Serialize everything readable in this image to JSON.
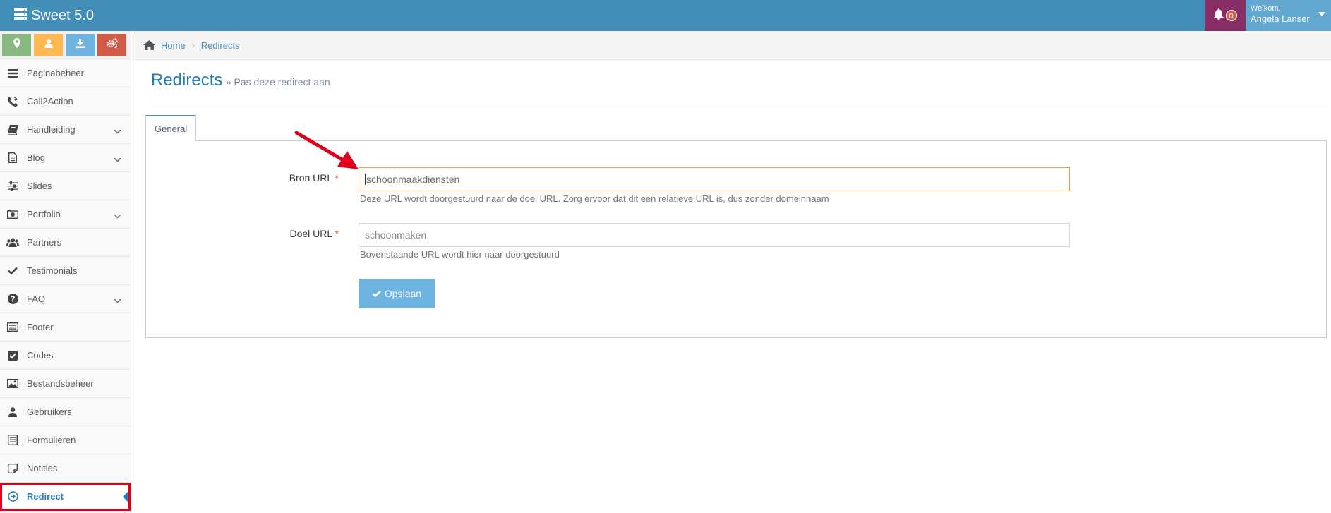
{
  "app": {
    "title": "Sweet 5.0"
  },
  "header": {
    "notifications_count": "0",
    "welcome_label": "Welkom,",
    "user_name": "Angela Lanser"
  },
  "shortcuts": [
    {
      "icon": "map-marker-icon",
      "color": "#87b87f"
    },
    {
      "icon": "user-icon",
      "color": "#ffb752"
    },
    {
      "icon": "download-icon",
      "color": "#6fb3e0"
    },
    {
      "icon": "cogs-icon",
      "color": "#d15b47"
    }
  ],
  "sidebar": {
    "items": [
      {
        "label": "Paginabeheer",
        "icon": "bars-icon"
      },
      {
        "label": "Call2Action",
        "icon": "phone-icon"
      },
      {
        "label": "Handleiding",
        "icon": "book-icon",
        "submenu": true
      },
      {
        "label": "Blog",
        "icon": "document-icon",
        "submenu": true
      },
      {
        "label": "Slides",
        "icon": "sliders-icon"
      },
      {
        "label": "Portfolio",
        "icon": "camera-icon",
        "submenu": true
      },
      {
        "label": "Partners",
        "icon": "users-icon"
      },
      {
        "label": "Testimonials",
        "icon": "check-icon"
      },
      {
        "label": "FAQ",
        "icon": "question-icon",
        "submenu": true
      },
      {
        "label": "Footer",
        "icon": "list-alt-icon"
      },
      {
        "label": "Codes",
        "icon": "check-square-icon"
      },
      {
        "label": "Bestandsbeheer",
        "icon": "image-icon"
      },
      {
        "label": "Gebruikers",
        "icon": "user-icon"
      },
      {
        "label": "Formulieren",
        "icon": "form-icon"
      },
      {
        "label": "Notities",
        "icon": "note-icon"
      },
      {
        "label": "Redirect",
        "icon": "arrow-circle-icon",
        "active": true
      }
    ]
  },
  "breadcrumb": {
    "home": "Home",
    "current": "Redirects"
  },
  "page": {
    "title": "Redirects",
    "subtitle": "» Pas deze redirect aan"
  },
  "tabs": [
    {
      "label": "General"
    }
  ],
  "form": {
    "source": {
      "label": "Bron URL",
      "required": "*",
      "value": "schoonmaakdiensten",
      "help": "Deze URL wordt doorgestuurd naar de doel URL. Zorg ervoor dat dit een relatieve URL is, dus zonder domeinnaam"
    },
    "target": {
      "label": "Doel URL",
      "required": "*",
      "value": "schoonmaken",
      "help": "Bovenstaande URL wordt hier naar doorgestuurd"
    },
    "save_label": "Opslaan"
  },
  "colors": {
    "topbar": "#438eb9",
    "notif_bg": "#892e65",
    "user_bg": "#62a8d1",
    "accent": "#2679b5",
    "highlight": "#e0001a"
  }
}
